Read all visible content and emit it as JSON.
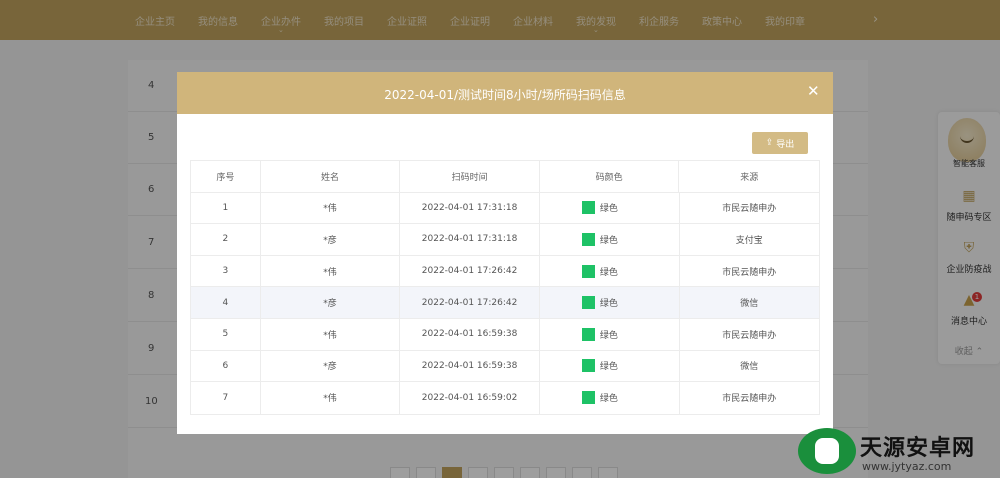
{
  "nav": {
    "items": [
      {
        "label": "企业主页",
        "has_caret": false
      },
      {
        "label": "我的信息",
        "has_caret": false
      },
      {
        "label": "企业办件",
        "has_caret": true
      },
      {
        "label": "我的项目",
        "has_caret": false
      },
      {
        "label": "企业证照",
        "has_caret": false
      },
      {
        "label": "企业证明",
        "has_caret": false
      },
      {
        "label": "企业材料",
        "has_caret": false
      },
      {
        "label": "我的发现",
        "has_caret": true
      },
      {
        "label": "利企服务",
        "has_caret": false
      },
      {
        "label": "政策中心",
        "has_caret": false
      },
      {
        "label": "我的印章",
        "has_caret": false
      }
    ],
    "more_icon": "chevron-right-icon"
  },
  "background_list": {
    "row_numbers": [
      "4",
      "5",
      "6",
      "7",
      "8",
      "9",
      "10"
    ]
  },
  "sidebar": {
    "items": [
      {
        "label": "智能客服",
        "icon": "robot-icon"
      },
      {
        "label": "随申码专区",
        "icon": "qrcode-icon"
      },
      {
        "label": "企业防疫战",
        "icon": "shield-icon"
      },
      {
        "label": "消息中心",
        "icon": "bell-icon"
      }
    ],
    "badge_count": "1",
    "collapse_label": "收起"
  },
  "modal": {
    "title": "2022-04-01/测试时间8小时/场所码扫码信息",
    "close_icon": "close-icon",
    "export_label": "导出",
    "export_icon": "upload-icon",
    "columns": [
      "序号",
      "姓名",
      "扫码时间",
      "码颜色",
      "来源"
    ],
    "swatch_color": "#1ec266",
    "rows": [
      {
        "index": "1",
        "name": "*伟",
        "time": "2022-04-01 17:31:18",
        "color": "绿色",
        "source": "市民云随申办"
      },
      {
        "index": "2",
        "name": "*彦",
        "time": "2022-04-01 17:31:18",
        "color": "绿色",
        "source": "支付宝"
      },
      {
        "index": "3",
        "name": "*伟",
        "time": "2022-04-01 17:26:42",
        "color": "绿色",
        "source": "市民云随申办"
      },
      {
        "index": "4",
        "name": "*彦",
        "time": "2022-04-01 17:26:42",
        "color": "绿色",
        "source": "微信"
      },
      {
        "index": "5",
        "name": "*伟",
        "time": "2022-04-01 16:59:38",
        "color": "绿色",
        "source": "市民云随申办"
      },
      {
        "index": "6",
        "name": "*彦",
        "time": "2022-04-01 16:59:38",
        "color": "绿色",
        "source": "微信"
      },
      {
        "index": "7",
        "name": "*伟",
        "time": "2022-04-01 16:59:02",
        "color": "绿色",
        "source": "市民云随申办"
      }
    ]
  },
  "watermark": {
    "name": "天源安卓网",
    "url": "www.jytyaz.com"
  },
  "colors": {
    "nav_bg": "#c2a45e",
    "modal_header": "#d0b57b",
    "export_btn": "#d3bb85"
  }
}
